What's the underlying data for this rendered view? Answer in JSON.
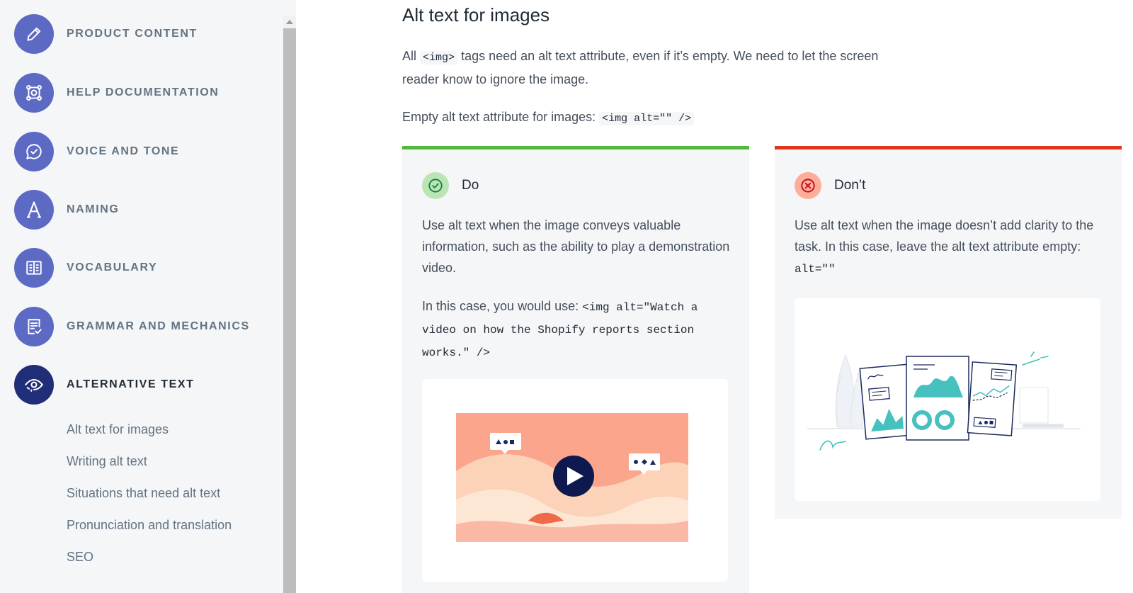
{
  "sidebar": {
    "items": [
      {
        "label": "Product content",
        "icon": "pencil-icon"
      },
      {
        "label": "Help documentation",
        "icon": "lifebuoy-icon"
      },
      {
        "label": "Voice and tone",
        "icon": "chat-check-icon"
      },
      {
        "label": "Naming",
        "icon": "letter-a-icon"
      },
      {
        "label": "Vocabulary",
        "icon": "book-icon"
      },
      {
        "label": "Grammar and mechanics",
        "icon": "checklist-icon"
      },
      {
        "label": "Alternative text",
        "icon": "eye-icon",
        "active": true
      }
    ],
    "subitems": [
      "Alt text for images",
      "Writing alt text",
      "Situations that need alt text",
      "Pronunciation and translation",
      "SEO"
    ]
  },
  "main": {
    "title": "Alt text for images",
    "intro_prefix": "All",
    "intro_code": "<img>",
    "intro_suffix": "tags need an alt text attribute, even if it’s empty. We need to let the screen reader know to ignore the image.",
    "empty_label": "Empty alt text attribute for images:",
    "empty_code": "<img alt=\"\" />",
    "do": {
      "label": "Do",
      "text1": "Use alt text when the image conveys valuable information, such as the ability to play a demonstration video.",
      "text2_prefix": "In this case, you would use:",
      "text2_code": "<img alt=\"Watch a video on how the Shopify reports section works.\" />"
    },
    "dont": {
      "label": "Don’t",
      "text1": "Use alt text when the image doesn’t add clarity to the task. In this case, leave the alt text attribute empty:",
      "text1_code": "alt=\"\""
    }
  },
  "colors": {
    "accent": "#5c6ac4",
    "active": "#202e78",
    "do": "#50b83c",
    "dont": "#de3618"
  }
}
